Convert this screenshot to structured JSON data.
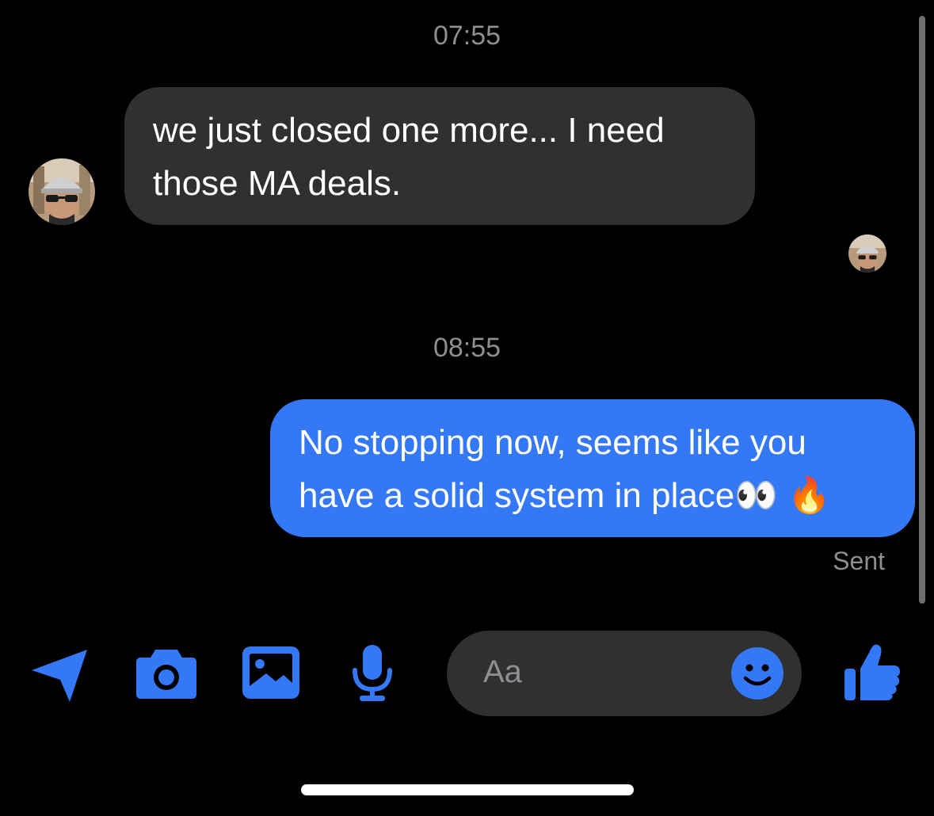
{
  "colors": {
    "background": "#000000",
    "accent": "#3478f6",
    "incoming_bubble": "#303030",
    "secondary_text": "#8e8e93"
  },
  "thread": [
    {
      "timestamp": "07:55",
      "message": {
        "direction": "incoming",
        "lines": [
          "we just closed one more... I need",
          "those MA deals."
        ]
      }
    },
    {
      "timestamp": "08:55",
      "message": {
        "direction": "outgoing",
        "lines": [
          "No stopping now, seems like you",
          "have a solid system in place👀 🔥"
        ],
        "status": "Sent"
      }
    }
  ],
  "composer": {
    "placeholder": "Aa",
    "icons": {
      "location": "location-arrow-icon",
      "camera": "camera-icon",
      "gallery": "photo-gallery-icon",
      "microphone": "microphone-icon",
      "emoji": "emoji-smile-icon",
      "like": "thumbs-up-icon"
    }
  }
}
